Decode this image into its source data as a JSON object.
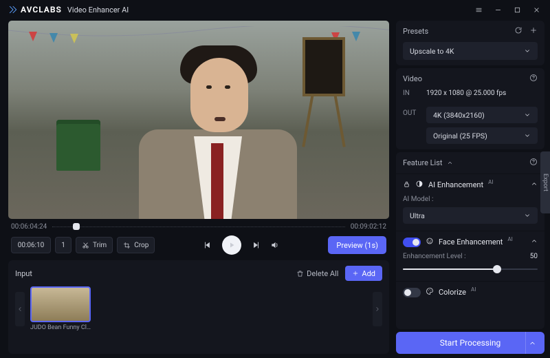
{
  "app": {
    "brand": "AVCLABS",
    "name": "Video Enhancer AI"
  },
  "timeline": {
    "start": "00:06:04:24",
    "end": "00:09:02:12"
  },
  "controls": {
    "timecode": "00:06:10",
    "frame_step": "1",
    "trim_label": "Trim",
    "crop_label": "Crop",
    "preview_label": "Preview (1s)"
  },
  "input": {
    "heading": "Input",
    "delete_all_label": "Delete All",
    "add_label": "Add",
    "clip_name": "JUDO Bean Funny Cli…"
  },
  "presets": {
    "heading": "Presets",
    "selected": "Upscale to 4K"
  },
  "video": {
    "heading": "Video",
    "in_label": "IN",
    "in_value": "1920 x 1080 @ 25.000 fps",
    "out_label": "OUT",
    "out_resolution": "4K (3840x2160)",
    "out_fps": "Original (25 FPS)"
  },
  "features": {
    "heading": "Feature List",
    "ai_enhancement": {
      "title": "AI Enhancement",
      "model_label": "AI Model :",
      "model_value": "Ultra"
    },
    "face_enhancement": {
      "title": "Face Enhancement",
      "level_label": "Enhancement Level :",
      "level_value": "50",
      "level_percent": 70
    },
    "colorize": {
      "title": "Colorize"
    }
  },
  "start_label": "Start Processing",
  "export_tab": "Export"
}
